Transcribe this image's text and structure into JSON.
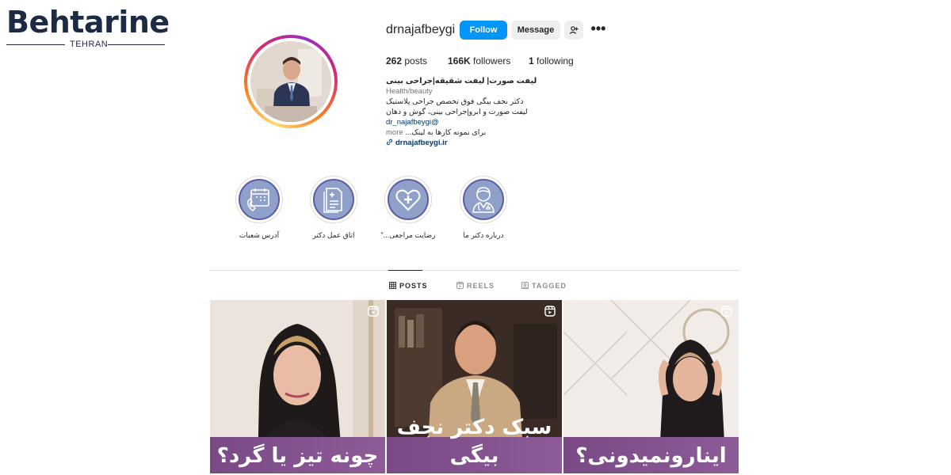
{
  "watermark": {
    "word": "Behtarine",
    "sub": "TEHRAN"
  },
  "profile": {
    "username": "drnajafbeygi",
    "follow_label": "Follow",
    "message_label": "Message",
    "stats": {
      "posts_count": "262",
      "posts_label": "posts",
      "followers_count": "166K",
      "followers_label": "followers",
      "following_count": "1",
      "following_label": "following"
    },
    "bio": {
      "name": "لیفت صورت| لیفت شقیقه|جراحی بینی",
      "category": "Health/beauty",
      "line1": "دکتر نجف بیگی فوق تخصص جراحی پلاستیک",
      "line2": "لیفت صورت و ابرو|جراحی بینی، گوش و دهان",
      "mention": "dr_najafbeygi@",
      "line3": "برای نمونه کارها به لینک...",
      "more": "more",
      "link": "drnajafbeygi.ir"
    }
  },
  "highlights": [
    {
      "label": "آدرس شعبات",
      "icon": "calendar-phone-icon"
    },
    {
      "label": "اتاق عمل دکتر",
      "icon": "medical-report-icon"
    },
    {
      "label": "رضایت مراجعی...\"",
      "icon": "heart-cross-icon"
    },
    {
      "label": "درباره دکتر ما",
      "icon": "doctor-icon"
    }
  ],
  "tabs": [
    {
      "label": "POSTS",
      "icon": "grid-icon",
      "active": true
    },
    {
      "label": "REELS",
      "icon": "reels-icon",
      "active": false
    },
    {
      "label": "TAGGED",
      "icon": "tag-icon",
      "active": false
    }
  ],
  "posts": [
    {
      "caption": "چونه تیز یا گرد؟",
      "icon": "reel-icon"
    },
    {
      "caption": "سبک دکتر نجف بیگی",
      "icon": "reel-icon"
    },
    {
      "caption": "اینارونمیدونی؟",
      "icon": "reel-icon"
    }
  ],
  "colors": {
    "accent": "#0095f6",
    "highlight_fill": "#8fa0c9",
    "highlight_border": "#5b5ea6",
    "post_banner": "#7a4a86"
  }
}
